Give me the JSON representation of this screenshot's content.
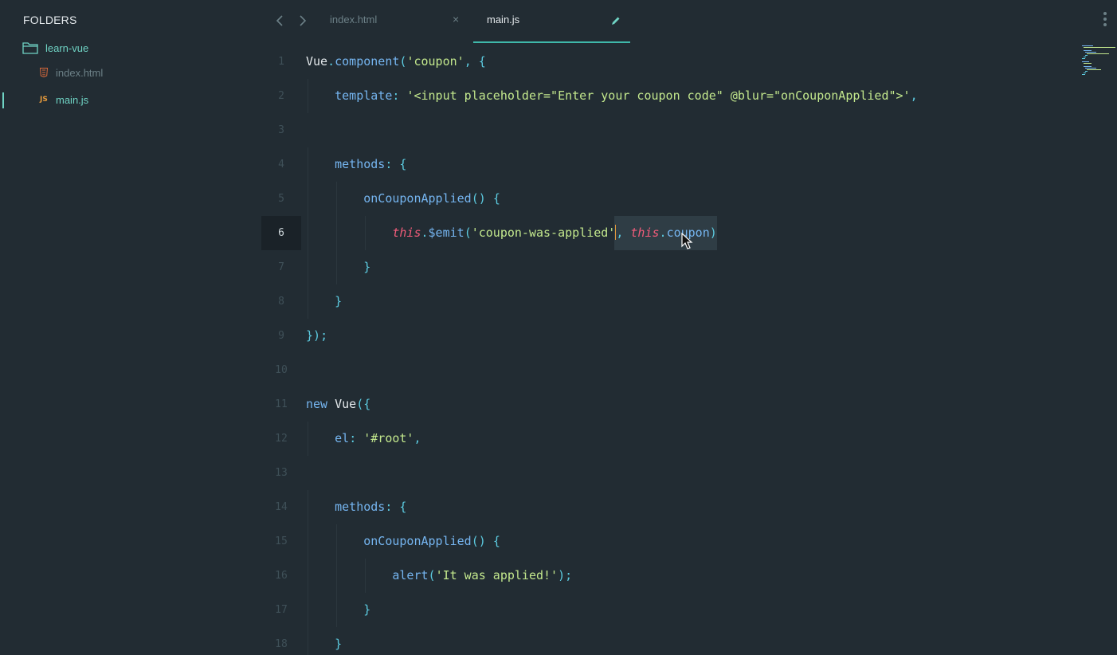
{
  "sidebar": {
    "title": "FOLDERS",
    "folder": {
      "name": "learn-vue",
      "icon": "folder-icon"
    },
    "files": [
      {
        "name": "index.html",
        "icon": "html5-icon",
        "active": false
      },
      {
        "name": "main.js",
        "icon": "JS",
        "active": true
      }
    ]
  },
  "tabs": [
    {
      "label": "index.html",
      "active": false,
      "close_glyph": "×"
    },
    {
      "label": "main.js",
      "active": true
    }
  ],
  "editor": {
    "current_line": 6,
    "lines": [
      {
        "n": "1",
        "code": "Vue.component('coupon', {"
      },
      {
        "n": "2",
        "code": "    template: '<input placeholder=\"Enter your coupon code\" @blur=\"onCouponApplied\">',"
      },
      {
        "n": "3",
        "code": ""
      },
      {
        "n": "4",
        "code": "    methods: {"
      },
      {
        "n": "5",
        "code": "        onCouponApplied() {"
      },
      {
        "n": "6",
        "code": "            this.$emit('coupon-was-applied', this.coupon)"
      },
      {
        "n": "7",
        "code": "        }"
      },
      {
        "n": "8",
        "code": "    }"
      },
      {
        "n": "9",
        "code": "});"
      },
      {
        "n": "10",
        "code": ""
      },
      {
        "n": "11",
        "code": "new Vue({"
      },
      {
        "n": "12",
        "code": "    el: '#root',"
      },
      {
        "n": "13",
        "code": ""
      },
      {
        "n": "14",
        "code": "    methods: {"
      },
      {
        "n": "15",
        "code": "        onCouponApplied() {"
      },
      {
        "n": "16",
        "code": "            alert('It was applied!');"
      },
      {
        "n": "17",
        "code": "        }"
      },
      {
        "n": "18",
        "code": "    }"
      }
    ]
  },
  "colors": {
    "background": "#222c33",
    "accent": "#3fb8aa",
    "string": "#c3e88d",
    "function": "#75b5f0",
    "this_keyword": "#f25c7a",
    "punctuation": "#5ccbe0"
  }
}
